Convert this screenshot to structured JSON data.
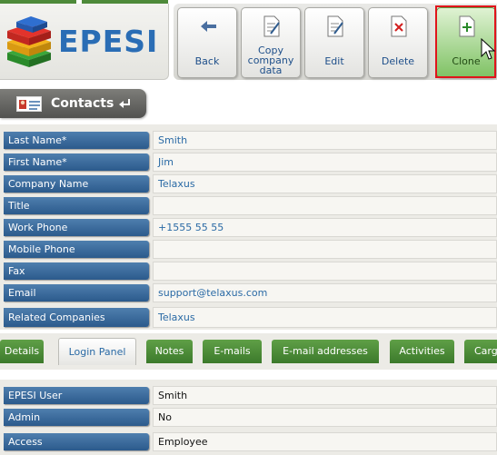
{
  "logo": {
    "text": "EPESI"
  },
  "toolbar": {
    "back_label": "Back",
    "copy_label_line1": "Copy",
    "copy_label_line2": "company",
    "copy_label_line3": "data",
    "edit_label": "Edit",
    "delete_label": "Delete",
    "clone_label": "Clone"
  },
  "module": {
    "title": "Contacts",
    "return_icon": "return-arrow-icon"
  },
  "fields": [
    {
      "label": "Last Name*",
      "value": "Smith"
    },
    {
      "label": "First Name*",
      "value": "Jim"
    },
    {
      "label": "Company Name",
      "value": "Telaxus"
    },
    {
      "label": "Title",
      "value": ""
    },
    {
      "label": "Work Phone",
      "value": "+1555 55 55"
    },
    {
      "label": "Mobile Phone",
      "value": ""
    },
    {
      "label": "Fax",
      "value": ""
    },
    {
      "label": "Email",
      "value": "support@telaxus.com"
    },
    {
      "label": "Related Companies",
      "value": "Telaxus"
    }
  ],
  "tabs": [
    {
      "label": "Details",
      "active": false
    },
    {
      "label": "Login Panel",
      "active": true
    },
    {
      "label": "Notes",
      "active": false
    },
    {
      "label": "E-mails",
      "active": false
    },
    {
      "label": "E-mail addresses",
      "active": false
    },
    {
      "label": "Activities",
      "active": false
    },
    {
      "label": "Cargo",
      "active": false
    }
  ],
  "login_panel": [
    {
      "label": "EPESI User",
      "value": "Smith"
    },
    {
      "label": "Admin",
      "value": "No"
    },
    {
      "label": "Access",
      "value": "Employee"
    }
  ],
  "colors": {
    "label_blue": "#2b5a8c",
    "tab_green": "#3c7a2b",
    "highlight_red": "#e0141b",
    "link_blue": "#2a6aa5"
  }
}
